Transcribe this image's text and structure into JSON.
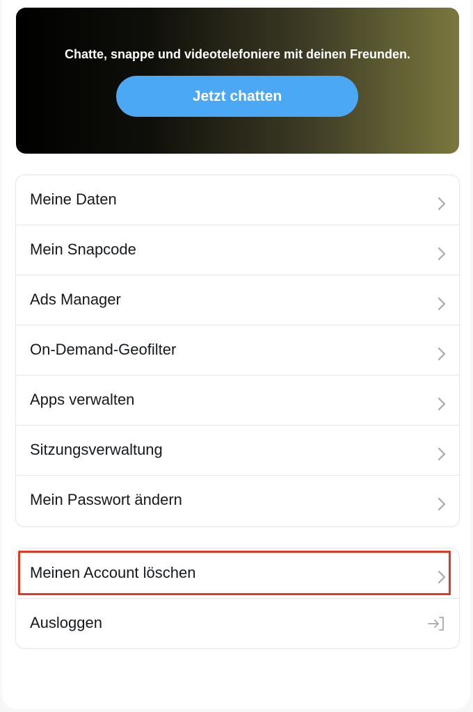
{
  "banner": {
    "text": "Chatte, snappe und videotelefoniere mit deinen Freunden.",
    "button_label": "Jetzt chatten"
  },
  "menu": {
    "items": [
      {
        "label": "Meine Daten",
        "icon": "chevron-right-icon"
      },
      {
        "label": "Mein Snapcode",
        "icon": "chevron-right-icon"
      },
      {
        "label": "Ads Manager",
        "icon": "chevron-right-icon"
      },
      {
        "label": "On-Demand-Geofilter",
        "icon": "chevron-right-icon"
      },
      {
        "label": "Apps verwalten",
        "icon": "chevron-right-icon"
      },
      {
        "label": "Sitzungsverwaltung",
        "icon": "chevron-right-icon"
      },
      {
        "label": "Mein Passwort ändern",
        "icon": "chevron-right-icon"
      }
    ]
  },
  "account": {
    "delete_label": "Meinen Account löschen",
    "logout_label": "Ausloggen",
    "delete_icon": "chevron-right-icon",
    "logout_icon": "logout-icon"
  },
  "colors": {
    "button": "#4aa8f5",
    "highlight": "#e03a26",
    "text": "#16191c",
    "chevron": "#a6a8ab"
  }
}
